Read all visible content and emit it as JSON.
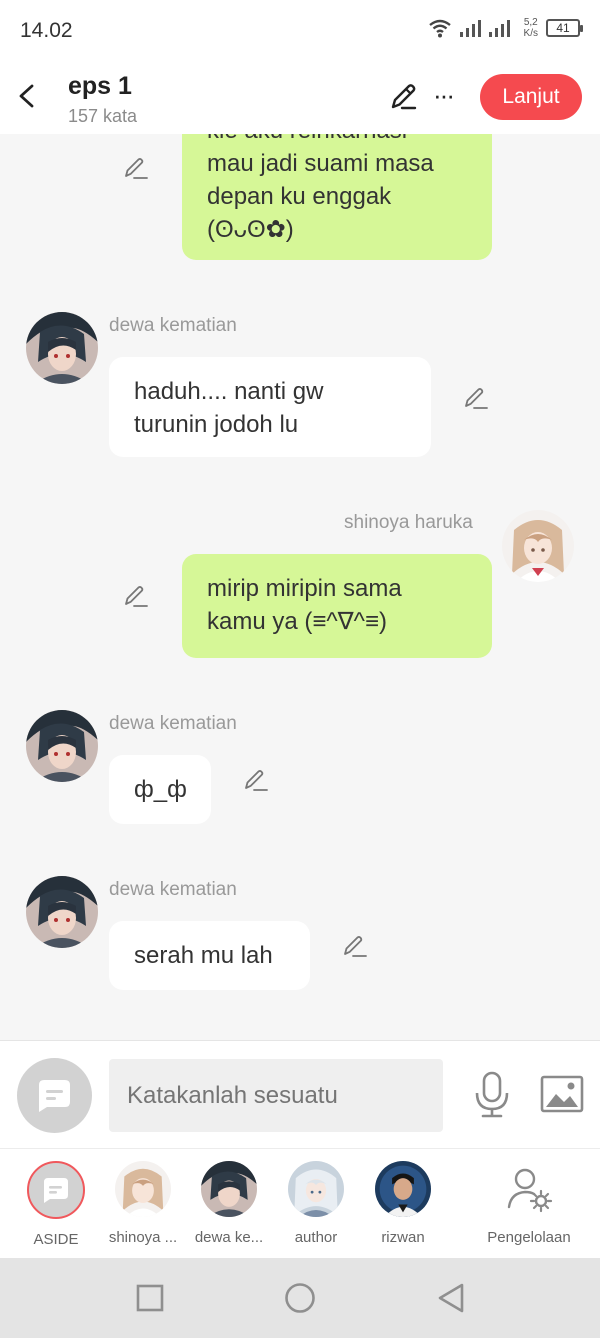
{
  "status": {
    "time": "14.02",
    "speed_top": "5,2",
    "speed_bottom": "K/s",
    "battery": "41"
  },
  "header": {
    "title": "eps 1",
    "subtitle": "157 kata",
    "next_label": "Lanjut",
    "more": "···"
  },
  "messages": [
    {
      "side": "out",
      "sender": "",
      "text_lines": [
        "kle aku reinkarnasi",
        "mau jadi suami masa",
        "depan ku enggak",
        "(ʘᴗʘ✿)"
      ]
    },
    {
      "side": "in",
      "sender": "dewa kematian",
      "text_lines": [
        "haduh.... nanti gw",
        "turunin jodoh lu"
      ]
    },
    {
      "side": "out",
      "sender": "shinoya haruka",
      "text_lines": [
        "mirip miripin sama",
        "kamu ya (≡^∇^≡)"
      ]
    },
    {
      "side": "in",
      "sender": "dewa kematian",
      "text_lines": [
        "ф_ф"
      ]
    },
    {
      "side": "in",
      "sender": "dewa kematian",
      "text_lines": [
        "serah mu lah"
      ]
    }
  ],
  "input": {
    "placeholder": "Katakanlah sesuatu"
  },
  "characters": [
    {
      "label": "ASIDE"
    },
    {
      "label": "shinoya ..."
    },
    {
      "label": "dewa ke..."
    },
    {
      "label": "author"
    },
    {
      "label": "rizwan"
    },
    {
      "label": "Pengelolaan"
    }
  ],
  "colors": {
    "accent": "#f54a4f",
    "bubble_out": "#d6f797",
    "bubble_in": "#ffffff"
  },
  "icons": [
    "back-icon",
    "pen-icon",
    "more-icon",
    "edit-icon",
    "aside-icon",
    "mic-icon",
    "image-icon",
    "manage-icon",
    "square-icon",
    "circle-icon",
    "triangle-back-icon",
    "wifi-icon",
    "signal-icon"
  ]
}
